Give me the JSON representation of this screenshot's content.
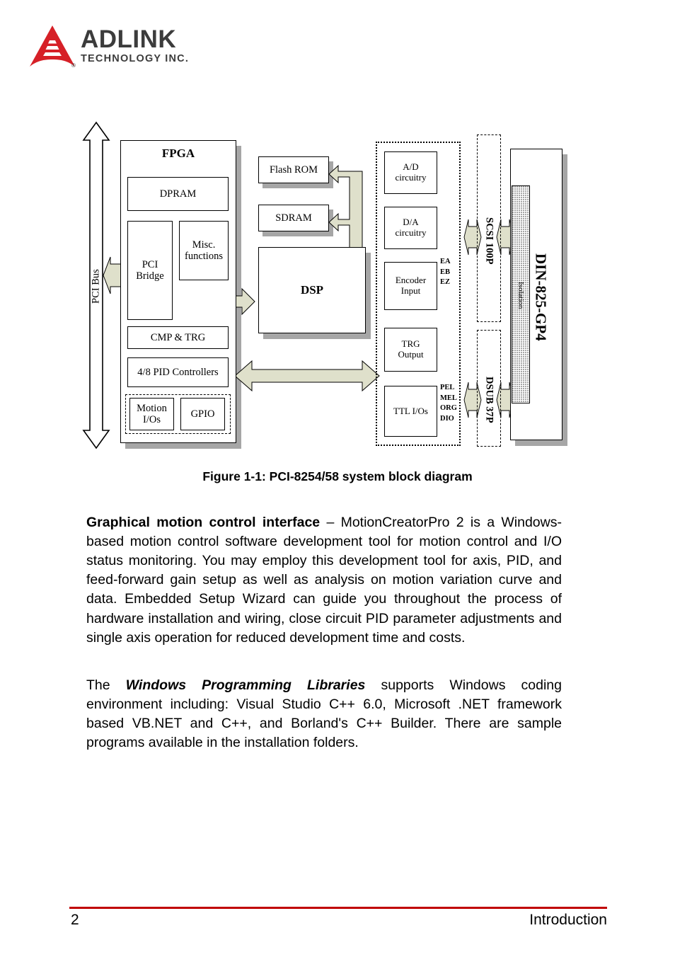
{
  "brand": {
    "name": "ADLINK",
    "tagline": "TECHNOLOGY INC.",
    "registered": "®"
  },
  "figure": {
    "caption": "Figure 1-1: PCI-8254/58 system block diagram",
    "bus_label": "PCI Bus",
    "fpga": {
      "title": "FPGA",
      "blocks": [
        {
          "label": "DPRAM"
        },
        {
          "label": "PCI\nBridge"
        },
        {
          "label": "Misc.\nfunctions"
        },
        {
          "label": "CMP & TRG"
        },
        {
          "label": "4/8 PID Controllers"
        },
        {
          "label": "Motion\nI/Os"
        },
        {
          "label": "GPIO"
        }
      ]
    },
    "memory": [
      {
        "label": "Flash ROM"
      },
      {
        "label": "SDRAM"
      }
    ],
    "processor": {
      "label": "DSP"
    },
    "io_blocks": [
      {
        "label": "A/D\ncircuitry",
        "signals": ""
      },
      {
        "label": "D/A\ncircuitry",
        "signals": ""
      },
      {
        "label": "Encoder\nInput",
        "signals": "EA\nEB\nEZ"
      },
      {
        "label": "TRG\nOutput",
        "signals": ""
      },
      {
        "label": "TTL I/Os",
        "signals": "PEL\nMEL\nORG\nDIO"
      }
    ],
    "connectors": [
      {
        "label": "SCSI 100P"
      },
      {
        "label": "DSUB 37P"
      }
    ],
    "terminal": {
      "label": "DIN-825-GP4",
      "isolation_label": "Isolation"
    },
    "colors": {
      "arrow_fill": "#dfe0cb",
      "arrow_stroke": "#000000",
      "shadow": "#a6a6a6"
    }
  },
  "body": {
    "paragraph_1": {
      "lead": "Graphical motion control interface",
      "text": " – MotionCreatorPro 2 is a Windows-based motion control software development tool for motion control and I/O status monitoring. You may employ this development tool for axis, PID, and feed-forward gain setup as well as analysis on motion variation curve and data. Embedded Setup Wizard can guide you throughout the process of hardware installation and wiring, close circuit PID parameter adjustments and single axis operation for reduced development time and costs."
    },
    "paragraph_2": {
      "prefix": "The ",
      "emphasis": "Windows Programming Libraries",
      "text": " supports Windows coding environment including: Visual Studio C++ 6.0, Microsoft .NET framework based VB.NET and C++, and Borland's C++ Builder. There are sample programs available in the installation folders."
    }
  },
  "footer": {
    "page_number": "2",
    "section": "Introduction",
    "rule_color": "#c00000"
  }
}
